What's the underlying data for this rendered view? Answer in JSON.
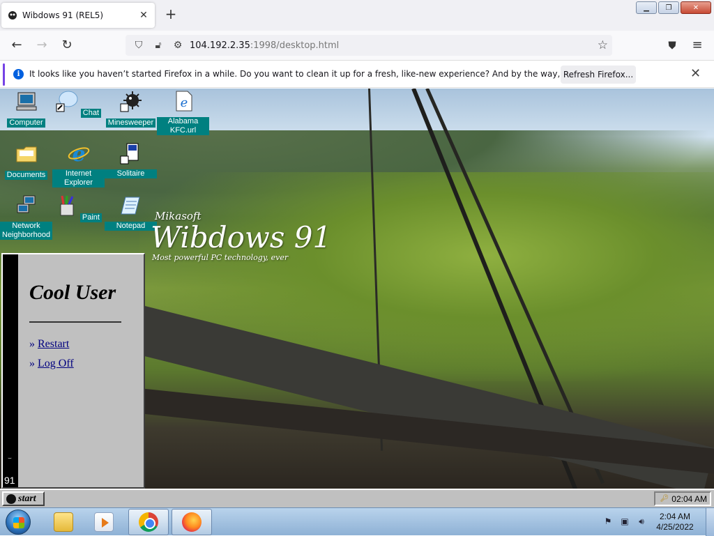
{
  "browser": {
    "tab_title": "Wibdows 91 (REL5)",
    "url_host": "104.192.2.35",
    "url_path": ":1998/desktop.html",
    "infobar_message": "It looks like you haven’t started Firefox in a while. Do you want to clean it up for a fresh, like-new experience? And by the way, welcome back!",
    "refresh_label": "Refresh Firefox..."
  },
  "desktop": {
    "icons": [
      {
        "label": "Computer",
        "icon": "computer-icon"
      },
      {
        "label": "Chat",
        "icon": "chat-bubble-icon"
      },
      {
        "label": "Minesweeper",
        "icon": "minesweeper-icon"
      },
      {
        "label": "Alabama KFC.url",
        "icon": "internet-shortcut-icon"
      },
      {
        "label": "Documents",
        "icon": "folder-icon"
      },
      {
        "label": "Internet Explorer",
        "icon": "internet-explorer-icon"
      },
      {
        "label": "Solitaire",
        "icon": "solitaire-icon"
      },
      {
        "label": "Network Neighborhood",
        "icon": "network-icon"
      },
      {
        "label": "Paint",
        "icon": "paint-icon"
      },
      {
        "label": "Notepad",
        "icon": "notepad-icon"
      }
    ],
    "brand": {
      "company": "Mikasoft",
      "product": "Wibdows 91",
      "tagline": "Most powerful PC technology, ever"
    }
  },
  "start_menu": {
    "user": "Cool User",
    "side_number": "91",
    "side_glyph": "⌣",
    "items": [
      "Restart",
      "Log Off"
    ]
  },
  "w91_taskbar": {
    "start_label": "start",
    "clock": "02:04 AM"
  },
  "win7_taskbar": {
    "time": "2:04 AM",
    "date": "4/25/2022"
  }
}
